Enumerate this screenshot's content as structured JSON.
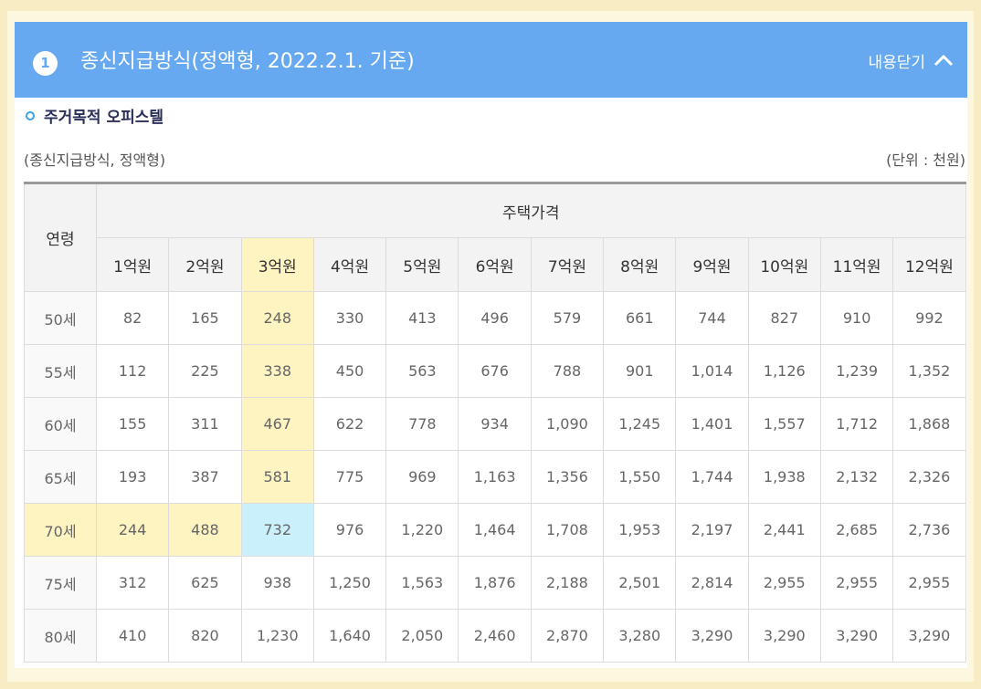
{
  "header": {
    "number": "1",
    "title": "종신지급방식(정액형, 2022.2.1. 기준)",
    "collapse_label": "내용닫기"
  },
  "subtitle": "주거목적 오피스텔",
  "caption_left": "(종신지급방식, 정액형)",
  "caption_right": "(단위 : 천원)",
  "table": {
    "age_header": "연령",
    "price_header": "주택가격",
    "columns": [
      "1억원",
      "2억원",
      "3억원",
      "4억원",
      "5억원",
      "6억원",
      "7억원",
      "8억원",
      "9억원",
      "10억원",
      "11억원",
      "12억원"
    ],
    "rows": [
      {
        "age": "50세",
        "values": [
          "82",
          "165",
          "248",
          "330",
          "413",
          "496",
          "579",
          "661",
          "744",
          "827",
          "910",
          "992"
        ]
      },
      {
        "age": "55세",
        "values": [
          "112",
          "225",
          "338",
          "450",
          "563",
          "676",
          "788",
          "901",
          "1,014",
          "1,126",
          "1,239",
          "1,352"
        ]
      },
      {
        "age": "60세",
        "values": [
          "155",
          "311",
          "467",
          "622",
          "778",
          "934",
          "1,090",
          "1,245",
          "1,401",
          "1,557",
          "1,712",
          "1,868"
        ]
      },
      {
        "age": "65세",
        "values": [
          "193",
          "387",
          "581",
          "775",
          "969",
          "1,163",
          "1,356",
          "1,550",
          "1,744",
          "1,938",
          "2,132",
          "2,326"
        ]
      },
      {
        "age": "70세",
        "values": [
          "244",
          "488",
          "732",
          "976",
          "1,220",
          "1,464",
          "1,708",
          "1,953",
          "2,197",
          "2,441",
          "2,685",
          "2,736"
        ]
      },
      {
        "age": "75세",
        "values": [
          "312",
          "625",
          "938",
          "1,250",
          "1,563",
          "1,876",
          "2,188",
          "2,501",
          "2,814",
          "2,955",
          "2,955",
          "2,955"
        ]
      },
      {
        "age": "80세",
        "values": [
          "410",
          "820",
          "1,230",
          "1,640",
          "2,050",
          "2,460",
          "2,870",
          "3,280",
          "3,290",
          "3,290",
          "3,290",
          "3,290"
        ]
      }
    ]
  },
  "colors": {
    "header_bg": "#66a9f1",
    "highlight_yellow": "#fdf4c2",
    "highlight_blue": "#c9f0fb"
  }
}
